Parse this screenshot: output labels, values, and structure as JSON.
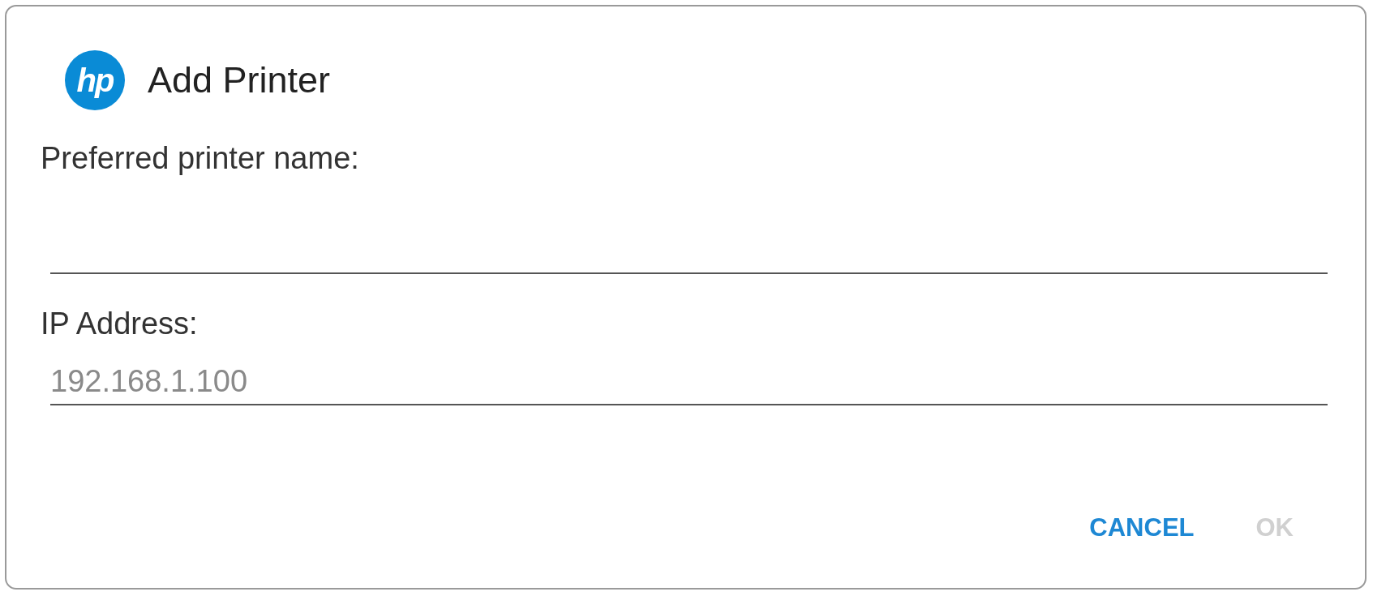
{
  "dialog": {
    "logo_text": "hp",
    "title": "Add Printer"
  },
  "fields": [
    {
      "label": "Preferred printer name:"
    },
    {
      "label": "IP Address:",
      "placeholder": "192.168.1.100"
    }
  ],
  "buttons": [
    {
      "label": "CANCEL",
      "disabled": false
    },
    {
      "label": "OK",
      "disabled": true
    }
  ]
}
